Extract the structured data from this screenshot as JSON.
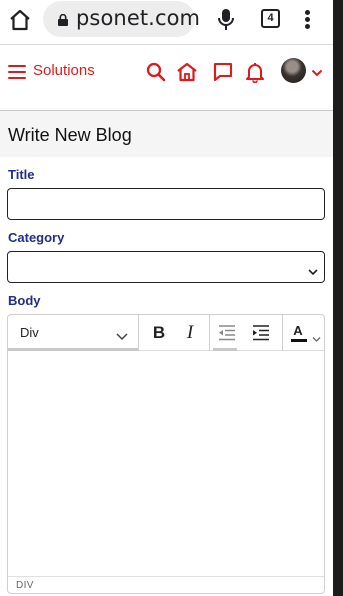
{
  "browser": {
    "url": "psonet.com",
    "tab_count": "4"
  },
  "header": {
    "brand": "Solutions"
  },
  "page": {
    "title": "Write New Blog"
  },
  "form": {
    "title_label": "Title",
    "title_value": "",
    "category_label": "Category",
    "category_value": "",
    "body_label": "Body"
  },
  "editor": {
    "format_value": "Div",
    "bold_label": "B",
    "italic_label": "I",
    "font_color_label": "A",
    "status_path": "DIV"
  },
  "colors": {
    "accent_red": "#e01a1a",
    "label_blue": "#1f2f87"
  }
}
